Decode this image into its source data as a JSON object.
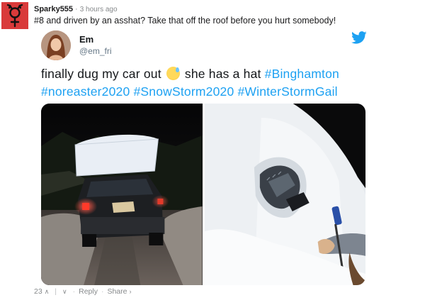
{
  "comment": {
    "username": "Sparky555",
    "time": "3 hours ago",
    "text": "#8 and driven by an asshat? Take that off the roof before you hurt somebody!",
    "icons": {
      "avatar": "mars-venus-symbol-icon"
    }
  },
  "tweet": {
    "name": "Em",
    "handle": "@em_fri",
    "text_before_emoji": "finally dug my car out",
    "text_after_emoji": "she has a hat",
    "hashtags": [
      "#Binghamton",
      "#noreaster2020",
      "#SnowStorm2020",
      "#WinterStormGail"
    ],
    "icons": {
      "brand": "twitter-bird-icon",
      "emoji": "grinning-sweat-emoji-icon"
    },
    "images": [
      {
        "name": "car-with-snow-roof-photo"
      },
      {
        "name": "snow-covered-car-mirror-photo"
      }
    ],
    "colors": {
      "hashtag": "#1da1f2",
      "brand": "#1da1f2"
    }
  },
  "actions": {
    "score": "23",
    "reply_label": "Reply",
    "share_label": "Share",
    "icons": {
      "up": "upvote-arrow-icon",
      "down": "downvote-arrow-icon",
      "share": "chevron-right-icon"
    }
  },
  "colors": {
    "accent": "#d93a3a",
    "meta": "#878a8c"
  }
}
